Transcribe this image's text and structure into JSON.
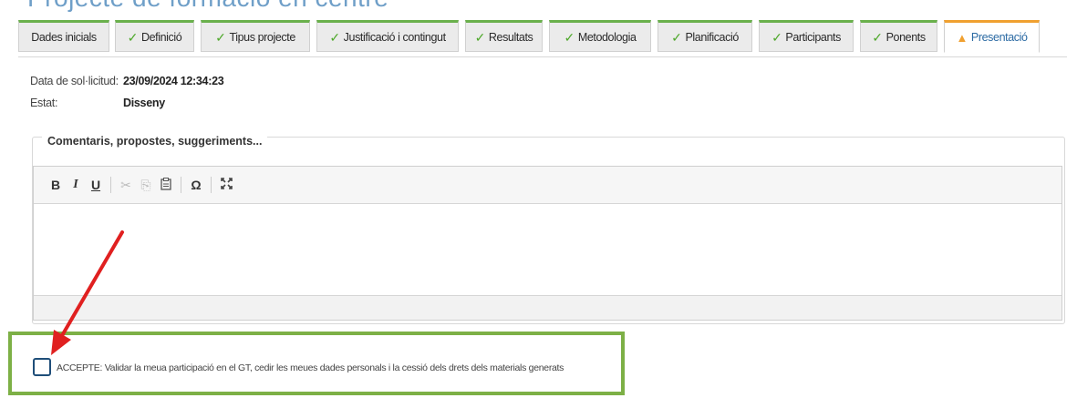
{
  "page": {
    "title": "Projecte de formació en centre"
  },
  "tabs": [
    {
      "label": "Dades inicials",
      "status": "none"
    },
    {
      "label": "Definició",
      "status": "done"
    },
    {
      "label": "Tipus projecte",
      "status": "done"
    },
    {
      "label": "Justificació i contingut",
      "status": "done"
    },
    {
      "label": "Resultats",
      "status": "done"
    },
    {
      "label": "Metodologia",
      "status": "done"
    },
    {
      "label": "Planificació",
      "status": "done"
    },
    {
      "label": "Participants",
      "status": "done"
    },
    {
      "label": "Ponents",
      "status": "done"
    },
    {
      "label": "Presentació",
      "status": "warning",
      "active": true
    }
  ],
  "info": {
    "date_label": "Data de sol·licitud:",
    "date_value": "23/09/2024 12:34:23",
    "state_label": "Estat:",
    "state_value": "Disseny"
  },
  "comments": {
    "legend": "Comentaris, propostes, suggeriments...",
    "value": "",
    "toolbar": [
      {
        "glyph": "B",
        "icon": "bold-icon"
      },
      {
        "glyph": "I",
        "icon": "italic-icon"
      },
      {
        "glyph": "U",
        "icon": "underline-icon"
      },
      {
        "glyph": "✂",
        "icon": "cut-icon"
      },
      {
        "glyph": "⎘",
        "icon": "copy-icon"
      },
      {
        "glyph": "📋",
        "icon": "paste-icon"
      },
      {
        "glyph": "Ω",
        "icon": "special-char-icon"
      },
      {
        "glyph": "⤢",
        "icon": "maximize-icon"
      }
    ]
  },
  "acceptance": {
    "checked": false,
    "label": "ACCEPTE: Validar la meua participació en el GT, cedir les meues dades personals i la cessió dels drets dels materials generats"
  },
  "colors": {
    "tab_done": "#6ab04c",
    "tab_active": "#f0a030",
    "highlight_box": "#7db046",
    "annotation_arrow": "#e02020"
  }
}
